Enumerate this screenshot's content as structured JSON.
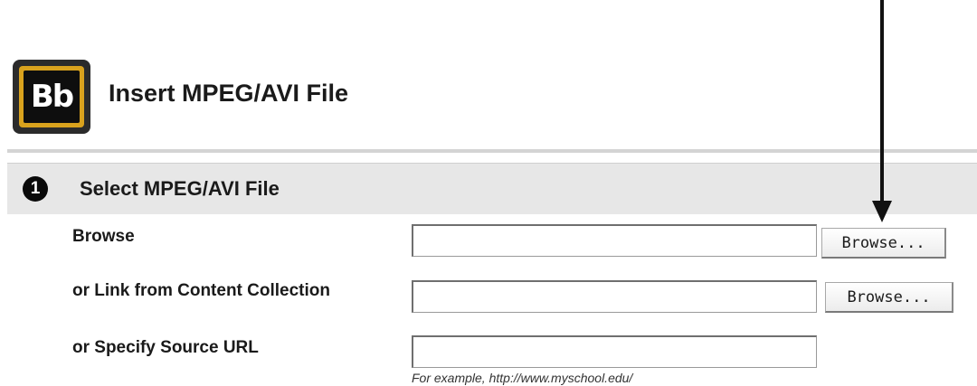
{
  "header": {
    "logo_text": "Bb",
    "title": "Insert MPEG/AVI File"
  },
  "section": {
    "step_number": "1",
    "title": "Select MPEG/AVI File"
  },
  "form": {
    "browse": {
      "label": "Browse",
      "value": "",
      "button_label": "Browse..."
    },
    "content_collection": {
      "label": "or Link from Content Collection",
      "value": "",
      "button_label": "Browse..."
    },
    "source_url": {
      "label": "or Specify Source URL",
      "value": "",
      "hint": "For example,  http://www.myschool.edu/"
    }
  },
  "colors": {
    "logo_frame": "#2b2b2b",
    "logo_gold": "#d9a21d",
    "section_band": "#e7e7e7",
    "arrow": "#111111"
  },
  "icons": {
    "logo": "blackboard-logo-icon",
    "step": "step-number-icon",
    "annotation": "down-arrow-icon"
  }
}
